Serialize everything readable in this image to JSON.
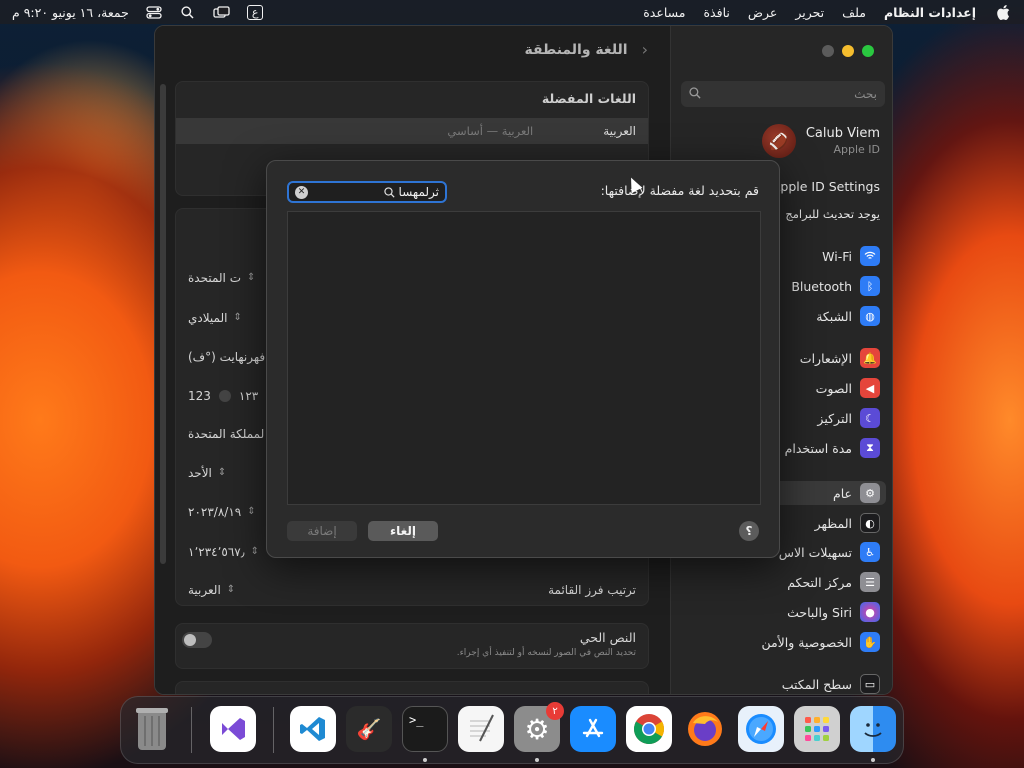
{
  "menubar": {
    "apple": "",
    "app_name": "إعدادات النظام",
    "menus": [
      "ملف",
      "تحرير",
      "عرض",
      "نافذة",
      "مساعدة"
    ],
    "input_source": "ع",
    "clock": "جمعة، ١٦ يونيو ٩:٢٠ م"
  },
  "settings": {
    "pane_title": "اللغة والمنطقة",
    "preferred_languages": {
      "title": "اللغات المفضلة",
      "primary": "العربية",
      "primary_detail": "العربية — أساسي"
    },
    "rows": {
      "region_value": "ت المتحدة",
      "calendar_value": "الميلادي",
      "temperature_value": "فهرنهايت (°ف)",
      "numbers_value_a": "١٢٣",
      "numbers_value_b": "123",
      "measurement_value": "لمملكة المتحدة",
      "first_day_value": "الأحد",
      "date_format_value": "٢٠٢٣/٨/١٩",
      "number_format_value": "١٬٢٣٤٬٥٦٧٫",
      "list_sort_label": "ترتيب فرز القائمة",
      "list_sort_value": "العربية"
    },
    "live_text": {
      "title": "النص الحي",
      "description": "تحديد النص في الصور لنسخه أو لتنفيذ أي إجراء."
    }
  },
  "sidebar": {
    "search_placeholder": "بحث",
    "account_name": "Calub Viem",
    "account_sub": "Apple ID",
    "apple_id_settings": "Apple ID Settings",
    "software_update": "يوجد تحديث للبرامج",
    "items": [
      {
        "label": "Wi-Fi",
        "icon": "wifi-icon",
        "color": "#2e7cf6"
      },
      {
        "label": "Bluetooth",
        "icon": "bluetooth-icon",
        "color": "#2e7cf6"
      },
      {
        "label": "الشبكة",
        "icon": "globe-icon",
        "color": "#2e7cf6"
      },
      {
        "label": "الإشعارات",
        "icon": "bell-icon",
        "color": "#e5453b"
      },
      {
        "label": "الصوت",
        "icon": "speaker-icon",
        "color": "#e5453b"
      },
      {
        "label": "التركيز",
        "icon": "moon-icon",
        "color": "#5b4bd6"
      },
      {
        "label": "مدة استخدام",
        "icon": "hourglass-icon",
        "color": "#5b4bd6"
      },
      {
        "label": "عام",
        "icon": "gear-icon",
        "color": "#8e8e93"
      },
      {
        "label": "المظهر",
        "icon": "appearance-icon",
        "color": "#1c1c1e"
      },
      {
        "label": "تسهيلات الاس",
        "icon": "accessibility-icon",
        "color": "#2e7cf6"
      },
      {
        "label": "مركز التحكم",
        "icon": "control-center-icon",
        "color": "#8e8e93"
      },
      {
        "label": "Siri والباحث",
        "icon": "siri-icon",
        "color": "#3a3a3c"
      },
      {
        "label": "الخصوصية والأمن",
        "icon": "hand-icon",
        "color": "#2e7cf6"
      },
      {
        "label": "سطح المكتب",
        "icon": "desktop-icon",
        "color": "#1c1c1e"
      }
    ]
  },
  "sheet": {
    "prompt": "قم بتحديد لغة مفضلة لإضافتها:",
    "search_value": "ثرلمهسا",
    "add_button": "إضافة",
    "cancel_button": "إلغاء",
    "help": "؟"
  },
  "dock": {
    "items": [
      {
        "name": "finder",
        "color": "#3aa0f0"
      },
      {
        "name": "launchpad",
        "color": "#c9c9c9"
      },
      {
        "name": "safari",
        "color": "#e8f1fb"
      },
      {
        "name": "firefox",
        "color": "#6a3ec7"
      },
      {
        "name": "chrome",
        "color": "#ffffff"
      },
      {
        "name": "app-store",
        "color": "#1a8cff"
      },
      {
        "name": "system-settings",
        "color": "#8c8c8c",
        "badge": "٢"
      },
      {
        "name": "textedit",
        "color": "#f6f6f6"
      },
      {
        "name": "terminal",
        "color": "#1b1b1b"
      },
      {
        "name": "garageband",
        "color": "#2b2b2b"
      },
      {
        "name": "vscode",
        "color": "#ffffff"
      },
      {
        "name": "visual-studio",
        "color": "#ffffff"
      },
      {
        "name": "trash",
        "color": "#6a6a6a"
      }
    ]
  }
}
